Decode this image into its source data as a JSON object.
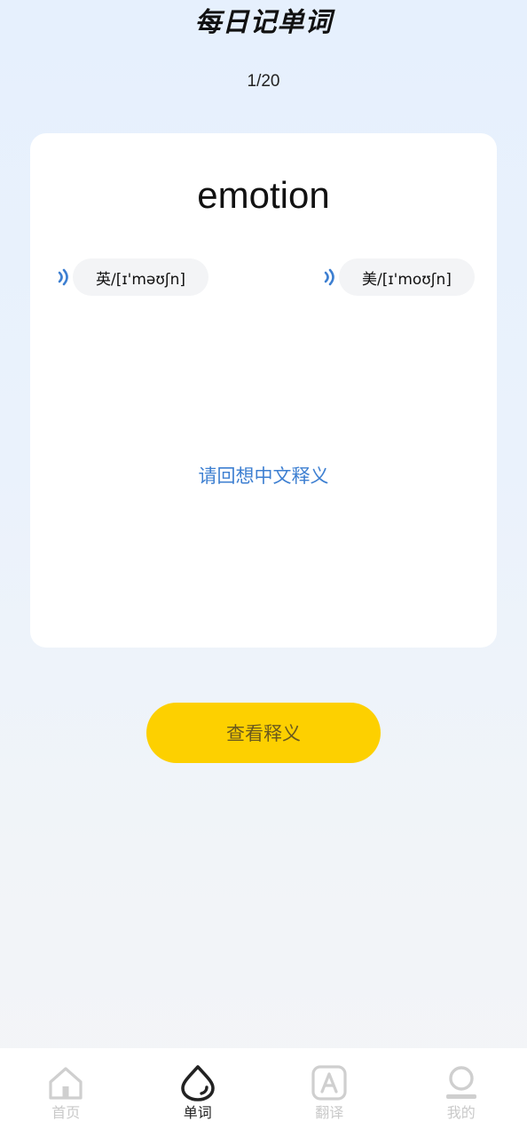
{
  "header": {
    "title": "每日记单词",
    "progress": "1/20"
  },
  "card": {
    "word": "emotion",
    "pronunciations": [
      {
        "region": "uk",
        "label": "英/[ɪ'məʊʃn]",
        "icon": "speaker-icon"
      },
      {
        "region": "us",
        "label": "美/[ɪ'moʊʃn]",
        "icon": "speaker-icon"
      }
    ],
    "hint": "请回想中文释义"
  },
  "actions": {
    "reveal_label": "查看释义"
  },
  "tabbar": {
    "items": [
      {
        "label": "首页",
        "icon": "home-icon",
        "active": false
      },
      {
        "label": "单词",
        "icon": "word-icon",
        "active": true
      },
      {
        "label": "翻译",
        "icon": "translate-icon",
        "active": false
      },
      {
        "label": "我的",
        "icon": "profile-icon",
        "active": false
      }
    ]
  },
  "colors": {
    "accent_yellow": "#fdd000",
    "hint_blue": "#3d7fd1",
    "inactive_tab": "#c9c9c9"
  }
}
